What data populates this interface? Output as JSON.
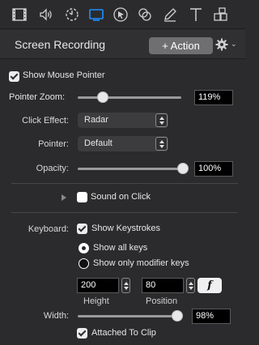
{
  "toolbar": {
    "tools": [
      {
        "icon": "film-icon",
        "selected": false
      },
      {
        "icon": "speaker-icon",
        "selected": false
      },
      {
        "icon": "timer-icon",
        "selected": false
      },
      {
        "icon": "screen-icon",
        "selected": true
      },
      {
        "icon": "cursor-icon",
        "selected": false
      },
      {
        "icon": "overlap-circles-icon",
        "selected": false
      },
      {
        "icon": "pencil-icon",
        "selected": false
      },
      {
        "icon": "text-icon",
        "selected": false
      },
      {
        "icon": "shapes-icon",
        "selected": false
      }
    ],
    "accent_color": "#1e90ff"
  },
  "header": {
    "title": "Screen Recording",
    "action_label": "+ Action"
  },
  "pointer": {
    "show_mouse_pointer_label": "Show Mouse Pointer",
    "show_mouse_pointer_checked": true,
    "zoom_label": "Pointer Zoom:",
    "zoom_value": "119%",
    "zoom_fraction": 0.24,
    "click_effect_label": "Click Effect:",
    "click_effect_value": "Radar",
    "pointer_label": "Pointer:",
    "pointer_value": "Default",
    "opacity_label": "Opacity:",
    "opacity_value": "100%",
    "opacity_fraction": 1.0
  },
  "sound": {
    "label": "Sound on Click",
    "checked": false
  },
  "keyboard": {
    "label": "Keyboard:",
    "show_keystrokes_label": "Show Keystrokes",
    "show_keystrokes_checked": true,
    "show_all_keys_label": "Show all keys",
    "show_modifier_keys_label": "Show only modifier keys",
    "selected_mode": "all",
    "height_value": "200",
    "height_label": "Height",
    "position_value": "80",
    "position_label": "Position",
    "fn_label": "f",
    "width_label": "Width:",
    "width_value": "98%",
    "width_fraction": 0.98,
    "attached_label": "Attached To Clip",
    "attached_checked": true
  }
}
